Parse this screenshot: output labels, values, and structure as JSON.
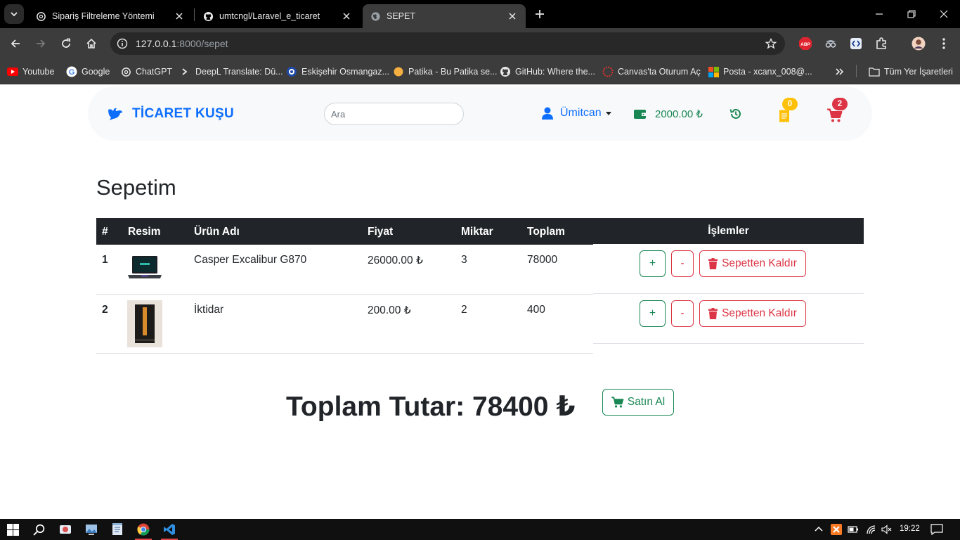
{
  "browser": {
    "tabs": [
      {
        "title": "Sipariş Filtreleme Yöntemi",
        "icon": "openai-icon",
        "active": false
      },
      {
        "title": "umtcngl/Laravel_e_ticaret",
        "icon": "github-icon",
        "active": false
      },
      {
        "title": "SEPET",
        "icon": "globe-icon",
        "active": true
      }
    ],
    "address": {
      "host": "127.0.0.1",
      "path": ":8000/sepet"
    },
    "bookmarks": [
      {
        "label": "Youtube",
        "icon": "youtube-icon"
      },
      {
        "label": "Google",
        "icon": "google-icon"
      },
      {
        "label": "ChatGPT",
        "icon": "openai-icon"
      },
      {
        "label": "DeepL Translate: Dü...",
        "icon": "deepl-icon"
      },
      {
        "label": "Eskişehir Osmangaz...",
        "icon": "university-icon"
      },
      {
        "label": "Patika - Bu Patika se...",
        "icon": "patika-icon"
      },
      {
        "label": "GitHub: Where the...",
        "icon": "github-icon"
      },
      {
        "label": "Canvas'ta Oturum Aç",
        "icon": "canvas-icon"
      },
      {
        "label": "Posta - xcanx_008@...",
        "icon": "microsoft-icon"
      }
    ],
    "all_bookmarks": "Tüm Yer İşaretleri",
    "extensions": [
      "adblock-icon",
      "spy-icon",
      "bracket-icon",
      "puzzle-icon",
      "profile-icon"
    ]
  },
  "site": {
    "brand": "TİCARET KUŞU",
    "search_placeholder": "Ara",
    "user_name": "Ümitcan",
    "wallet": "2000.00 ₺",
    "receipt_count": "0",
    "cart_count": "2",
    "colors": {
      "primary": "#0d6efd",
      "success": "#198754",
      "danger": "#dc3545",
      "warning": "#ffc107",
      "dark": "#212529"
    }
  },
  "cart": {
    "title": "Sepetim",
    "headers": {
      "num": "#",
      "image": "Resim",
      "name": "Ürün Adı",
      "price": "Fiyat",
      "qty": "Miktar",
      "total": "Toplam",
      "actions": "İşlemler"
    },
    "rows": [
      {
        "num": "1",
        "name": "Casper Excalibur G870",
        "price": "26000.00 ₺",
        "qty": "3",
        "total": "78000",
        "image": "laptop-image"
      },
      {
        "num": "2",
        "name": "İktidar",
        "price": "200.00 ₺",
        "qty": "2",
        "total": "400",
        "image": "book-image"
      }
    ],
    "buttons": {
      "plus": "+",
      "minus": "-",
      "remove": "Sepetten Kaldır"
    },
    "grand_total": "Toplam Tutar: 78400 ₺",
    "buy_label": "Satın Al"
  },
  "taskbar": {
    "time": "19:22"
  }
}
